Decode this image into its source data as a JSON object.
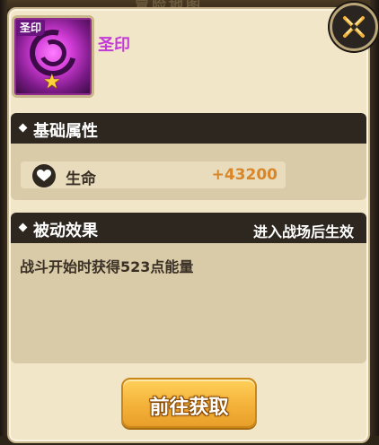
{
  "background_title": "冒险地图",
  "item": {
    "tag": "圣印",
    "name": "圣印",
    "stars": "★"
  },
  "basic_attributes": {
    "title": "基础属性",
    "rows": [
      {
        "icon": "heart-icon",
        "label": "生命",
        "value": "+43200"
      }
    ]
  },
  "passive_effect": {
    "title": "被动效果",
    "condition": "进入战场后生效",
    "description": "战斗开始时获得523点能量"
  },
  "actions": {
    "go_button": "前往获取",
    "close_icon": "crossed-swords-icon"
  },
  "colors": {
    "panel": "#f2e6c8",
    "section_header": "#2e2720",
    "section_body": "#d9cba7",
    "item_name": "#c23ad8",
    "attr_value": "#d8862a",
    "button": "#f4b23a"
  }
}
